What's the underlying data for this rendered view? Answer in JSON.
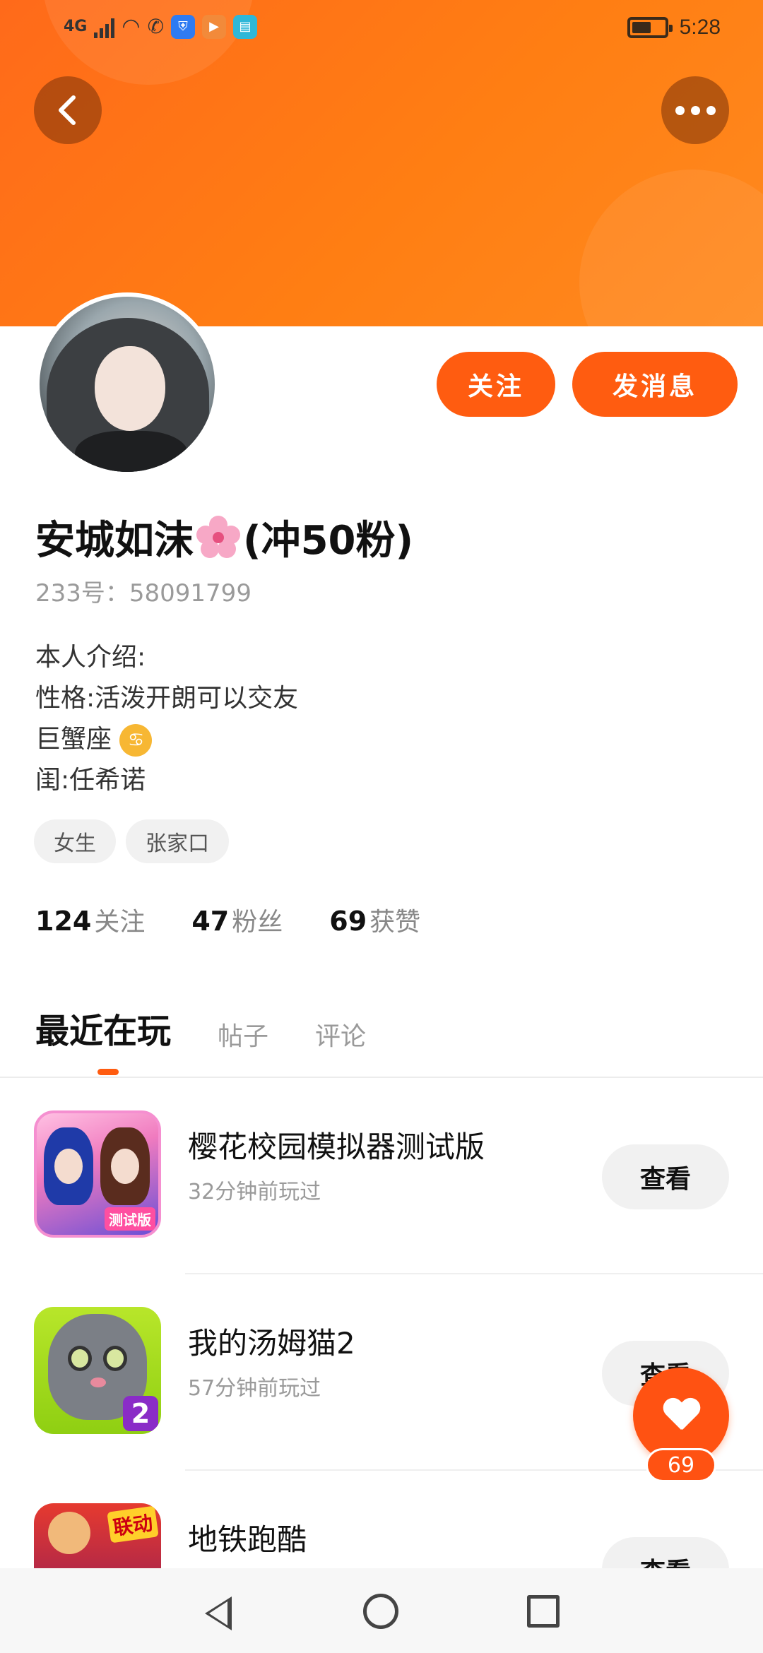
{
  "status_bar": {
    "network": "4G",
    "time": "5:28",
    "colors": {
      "shield": "#2f7bf2",
      "play": "#f28a3a",
      "book": "#2fb7d8"
    }
  },
  "header": {
    "back_icon": "chevron-left-icon",
    "more_icon": "more-horizontal-icon",
    "gradient": [
      "#ff6a1a",
      "#ff8a1f"
    ]
  },
  "profile": {
    "name_main": "安城如沫",
    "name_suffix": "(冲50粉)",
    "uid": "233号：58091799",
    "bio": [
      "本人介绍:",
      "性格:活泼开朗可以交友",
      "巨蟹座",
      "闺:任希诺"
    ],
    "tags": [
      "女生",
      "张家口"
    ],
    "stats": [
      {
        "num": "124",
        "label": "关注"
      },
      {
        "num": "47",
        "label": "粉丝"
      },
      {
        "num": "69",
        "label": "获赞"
      }
    ]
  },
  "actions": {
    "follow_label": "关注",
    "message_label": "发消息",
    "accent": "#ff5c10"
  },
  "tabs": [
    "最近在玩",
    "帖子",
    "评论"
  ],
  "games": [
    {
      "title": "樱花校园模拟器测试版",
      "time": "32分钟前玩过",
      "button": "查看",
      "badge": "测试版"
    },
    {
      "title": "我的汤姆猫2",
      "time": "57分钟前玩过",
      "button": "查看",
      "badge": "2"
    },
    {
      "title": "地铁跑酷",
      "time": "",
      "button": "查看",
      "badge": "联动"
    }
  ],
  "like_fab": {
    "count": "69"
  }
}
